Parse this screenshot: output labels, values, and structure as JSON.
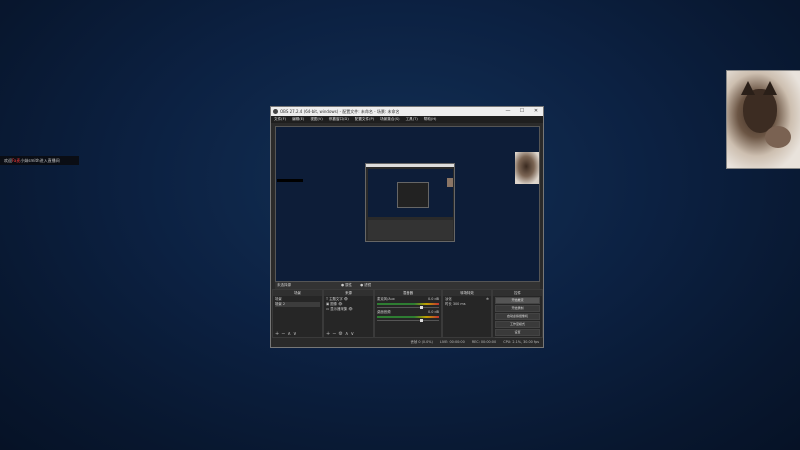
{
  "overlay": {
    "ticker": {
      "before": "欢迎",
      "highlight": "Fa麦",
      "after": "小妹smith进入直播间"
    }
  },
  "obs": {
    "title": "OBS 27.2.4 (64-bit, windows) - 配置文件: 未命名 - 场景: 未命名",
    "window_controls": [
      "—",
      "☐",
      "✕"
    ],
    "menu": [
      "文件(F)",
      "编辑(E)",
      "视图(V)",
      "停靠窗口(D)",
      "配置文件(P)",
      "场景集合(S)",
      "工具(T)",
      "帮助(H)"
    ],
    "status_label": "未选择源",
    "preview_tabs": [
      "属性",
      "滤镜"
    ],
    "docks": {
      "scenes": {
        "title": "场景",
        "items": [
          "场景",
          "场景 2"
        ]
      },
      "sources": {
        "title": "来源",
        "items": [
          "主题文字",
          "图像",
          "显示器采集"
        ]
      },
      "mixer": {
        "title": "混音器",
        "channels": [
          {
            "name": "麦克风/Aux",
            "db": "0.0 dB"
          },
          {
            "name": "桌面音频",
            "db": "0.0 dB"
          }
        ]
      },
      "transitions": {
        "title": "转场特效",
        "type": "淡化",
        "duration_label": "时长",
        "duration": "300 ms"
      },
      "controls": {
        "title": "控件",
        "buttons": [
          "开始推流",
          "开始录制",
          "启动虚拟摄像机",
          "工作室模式",
          "设置",
          "退出"
        ]
      }
    },
    "statusbar": {
      "dropped": "丢帧 0 (0.0%)",
      "live": "LIVE: 00:00:00",
      "rec": "REC: 00:00:00",
      "cpu": "CPU: 2.1%, 30.00 fps"
    }
  }
}
